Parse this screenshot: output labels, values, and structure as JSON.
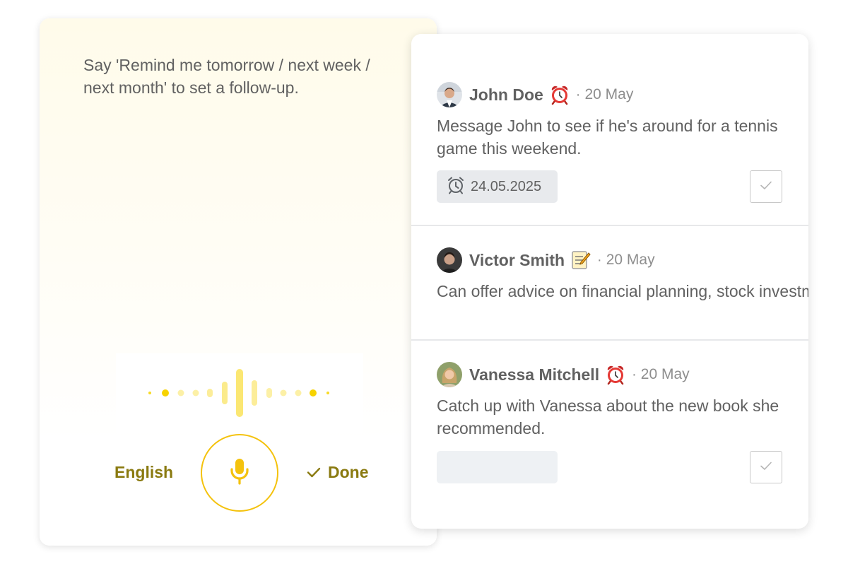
{
  "voice": {
    "prompt": "Say 'Remind me tomorrow / next week / next month' to set a follow-up.",
    "language_label": "English",
    "done_label": "Done",
    "accent_color": "#f4c20d",
    "label_color": "#8a7a10",
    "icons": {
      "mic": "microphone-icon",
      "done": "checkmark-icon"
    }
  },
  "reminders": [
    {
      "name": "John Doe",
      "status_icon": "alarm-clock-icon",
      "separator": "·",
      "date": "20 May",
      "text": "Message John to see if he's around for a tennis game this weekend.",
      "reminder_date": "24.05.2025",
      "completed": false
    },
    {
      "name": "Victor Smith",
      "status_icon": "memo-icon",
      "separator": "·",
      "date": "20 May",
      "text": "Can offer advice on financial planning, stock investments, and budgeting for business ne..."
    },
    {
      "name": "Vanessa Mitchell",
      "status_icon": "alarm-clock-icon",
      "separator": "·",
      "date": "20 May",
      "text": "Catch up with Vanessa about the new book she recommended.",
      "reminder_date": "",
      "completed": false
    }
  ]
}
